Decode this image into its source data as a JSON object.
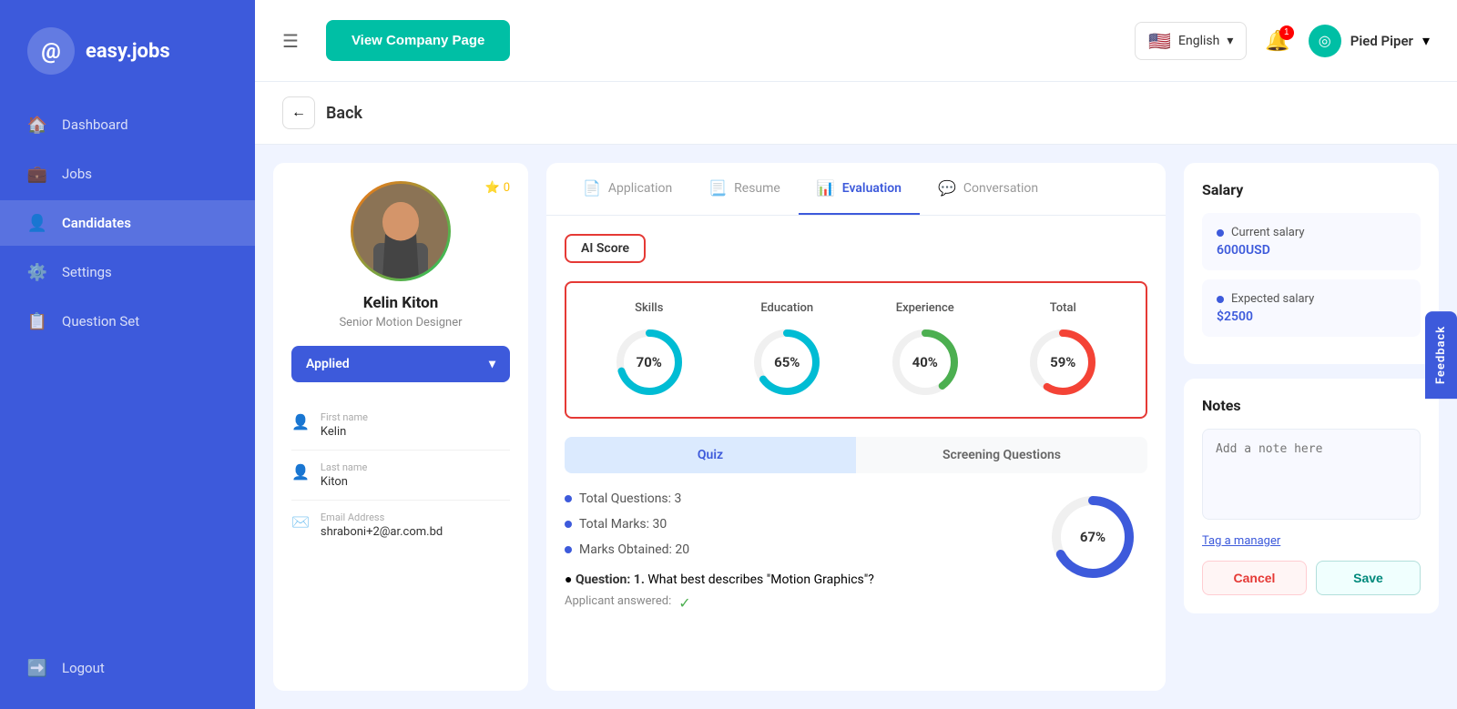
{
  "sidebar": {
    "logo_text": "easy.jobs",
    "items": [
      {
        "label": "Dashboard",
        "icon": "🏠",
        "active": false
      },
      {
        "label": "Jobs",
        "icon": "💼",
        "active": false
      },
      {
        "label": "Candidates",
        "icon": "👤",
        "active": true
      },
      {
        "label": "Settings",
        "icon": "⚙️",
        "active": false
      },
      {
        "label": "Question Set",
        "icon": "📋",
        "active": false
      }
    ],
    "logout_label": "Logout",
    "logout_icon": "➡️"
  },
  "header": {
    "view_company_btn": "View Company Page",
    "language": "English",
    "notification_count": "1",
    "company_name": "Pied Piper"
  },
  "back": {
    "label": "Back"
  },
  "candidate": {
    "name": "Kelin Kiton",
    "title": "Senior Motion Designer",
    "star_count": "0",
    "status": "Applied",
    "first_name_label": "First name",
    "first_name": "Kelin",
    "last_name_label": "Last name",
    "last_name": "Kiton",
    "email_label": "Email Address",
    "email": "shraboni+2@ar.com.bd"
  },
  "tabs": [
    {
      "label": "Application",
      "icon": "📄"
    },
    {
      "label": "Resume",
      "icon": "📃"
    },
    {
      "label": "Evaluation",
      "icon": "📊"
    },
    {
      "label": "Conversation",
      "icon": "💬"
    }
  ],
  "active_tab": "Evaluation",
  "ai_score": {
    "label": "AI Score",
    "scores": [
      {
        "label": "Skills",
        "value": 70,
        "color": "#00bcd4"
      },
      {
        "label": "Education",
        "value": 65,
        "color": "#00bcd4"
      },
      {
        "label": "Experience",
        "value": 40,
        "color": "#4caf50"
      },
      {
        "label": "Total",
        "value": 59,
        "color": "#f44336"
      }
    ]
  },
  "sub_tabs": [
    {
      "label": "Quiz",
      "active": true
    },
    {
      "label": "Screening Questions",
      "active": false
    }
  ],
  "quiz": {
    "total_questions_label": "Total Questions: 3",
    "total_marks_label": "Total Marks: 30",
    "marks_obtained_label": "Marks Obtained: 20",
    "donut_value": "67%",
    "donut_color": "#3d5adb",
    "donut_percent": 67,
    "question_label": "Question: 1.",
    "question_text": "What best describes \"Motion Graphics\"?",
    "answer_prefix": "Applicant answered:"
  },
  "salary": {
    "section_label": "Salary",
    "current_label": "Current salary",
    "current_amount": "6000USD",
    "expected_label": "Expected salary",
    "expected_amount": "$2500"
  },
  "notes": {
    "section_label": "Notes",
    "placeholder": "Add a note here",
    "tag_manager_label": "Tag a manager",
    "cancel_label": "Cancel",
    "save_label": "Save"
  },
  "feedback_label": "Feedback"
}
